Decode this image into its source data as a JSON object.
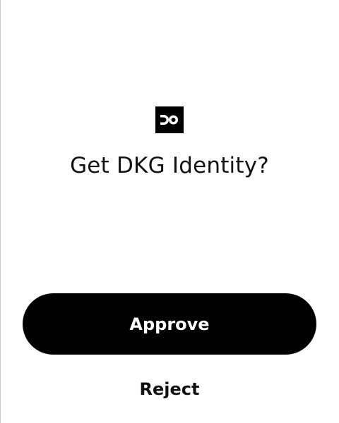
{
  "dialog": {
    "title": "Get DKG Identity?",
    "logo_icon": "dkg-logo-icon",
    "approve_label": "Approve",
    "reject_label": "Reject"
  },
  "colors": {
    "background": "#ffffff",
    "primary_button": "#000000",
    "primary_button_text": "#ffffff",
    "text": "#111111"
  }
}
